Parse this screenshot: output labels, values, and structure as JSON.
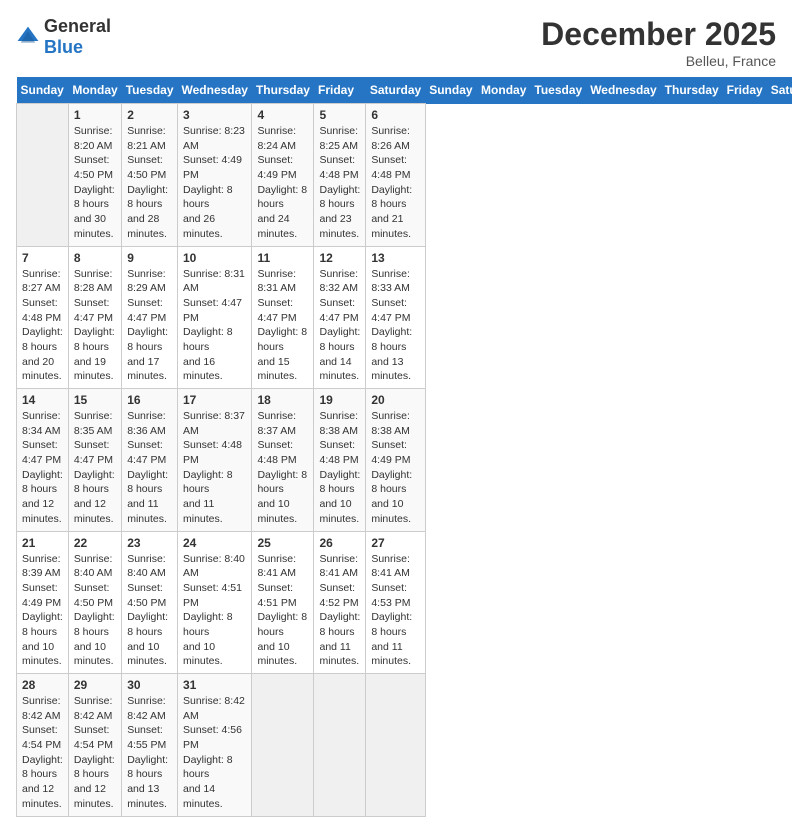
{
  "header": {
    "logo_general": "General",
    "logo_blue": "Blue",
    "month_title": "December 2025",
    "location": "Belleu, France"
  },
  "days_of_week": [
    "Sunday",
    "Monday",
    "Tuesday",
    "Wednesday",
    "Thursday",
    "Friday",
    "Saturday"
  ],
  "weeks": [
    [
      {
        "day": "",
        "info": ""
      },
      {
        "day": "1",
        "info": "Sunrise: 8:20 AM\nSunset: 4:50 PM\nDaylight: 8 hours\nand 30 minutes."
      },
      {
        "day": "2",
        "info": "Sunrise: 8:21 AM\nSunset: 4:50 PM\nDaylight: 8 hours\nand 28 minutes."
      },
      {
        "day": "3",
        "info": "Sunrise: 8:23 AM\nSunset: 4:49 PM\nDaylight: 8 hours\nand 26 minutes."
      },
      {
        "day": "4",
        "info": "Sunrise: 8:24 AM\nSunset: 4:49 PM\nDaylight: 8 hours\nand 24 minutes."
      },
      {
        "day": "5",
        "info": "Sunrise: 8:25 AM\nSunset: 4:48 PM\nDaylight: 8 hours\nand 23 minutes."
      },
      {
        "day": "6",
        "info": "Sunrise: 8:26 AM\nSunset: 4:48 PM\nDaylight: 8 hours\nand 21 minutes."
      }
    ],
    [
      {
        "day": "7",
        "info": "Sunrise: 8:27 AM\nSunset: 4:48 PM\nDaylight: 8 hours\nand 20 minutes."
      },
      {
        "day": "8",
        "info": "Sunrise: 8:28 AM\nSunset: 4:47 PM\nDaylight: 8 hours\nand 19 minutes."
      },
      {
        "day": "9",
        "info": "Sunrise: 8:29 AM\nSunset: 4:47 PM\nDaylight: 8 hours\nand 17 minutes."
      },
      {
        "day": "10",
        "info": "Sunrise: 8:31 AM\nSunset: 4:47 PM\nDaylight: 8 hours\nand 16 minutes."
      },
      {
        "day": "11",
        "info": "Sunrise: 8:31 AM\nSunset: 4:47 PM\nDaylight: 8 hours\nand 15 minutes."
      },
      {
        "day": "12",
        "info": "Sunrise: 8:32 AM\nSunset: 4:47 PM\nDaylight: 8 hours\nand 14 minutes."
      },
      {
        "day": "13",
        "info": "Sunrise: 8:33 AM\nSunset: 4:47 PM\nDaylight: 8 hours\nand 13 minutes."
      }
    ],
    [
      {
        "day": "14",
        "info": "Sunrise: 8:34 AM\nSunset: 4:47 PM\nDaylight: 8 hours\nand 12 minutes."
      },
      {
        "day": "15",
        "info": "Sunrise: 8:35 AM\nSunset: 4:47 PM\nDaylight: 8 hours\nand 12 minutes."
      },
      {
        "day": "16",
        "info": "Sunrise: 8:36 AM\nSunset: 4:47 PM\nDaylight: 8 hours\nand 11 minutes."
      },
      {
        "day": "17",
        "info": "Sunrise: 8:37 AM\nSunset: 4:48 PM\nDaylight: 8 hours\nand 11 minutes."
      },
      {
        "day": "18",
        "info": "Sunrise: 8:37 AM\nSunset: 4:48 PM\nDaylight: 8 hours\nand 10 minutes."
      },
      {
        "day": "19",
        "info": "Sunrise: 8:38 AM\nSunset: 4:48 PM\nDaylight: 8 hours\nand 10 minutes."
      },
      {
        "day": "20",
        "info": "Sunrise: 8:38 AM\nSunset: 4:49 PM\nDaylight: 8 hours\nand 10 minutes."
      }
    ],
    [
      {
        "day": "21",
        "info": "Sunrise: 8:39 AM\nSunset: 4:49 PM\nDaylight: 8 hours\nand 10 minutes."
      },
      {
        "day": "22",
        "info": "Sunrise: 8:40 AM\nSunset: 4:50 PM\nDaylight: 8 hours\nand 10 minutes."
      },
      {
        "day": "23",
        "info": "Sunrise: 8:40 AM\nSunset: 4:50 PM\nDaylight: 8 hours\nand 10 minutes."
      },
      {
        "day": "24",
        "info": "Sunrise: 8:40 AM\nSunset: 4:51 PM\nDaylight: 8 hours\nand 10 minutes."
      },
      {
        "day": "25",
        "info": "Sunrise: 8:41 AM\nSunset: 4:51 PM\nDaylight: 8 hours\nand 10 minutes."
      },
      {
        "day": "26",
        "info": "Sunrise: 8:41 AM\nSunset: 4:52 PM\nDaylight: 8 hours\nand 11 minutes."
      },
      {
        "day": "27",
        "info": "Sunrise: 8:41 AM\nSunset: 4:53 PM\nDaylight: 8 hours\nand 11 minutes."
      }
    ],
    [
      {
        "day": "28",
        "info": "Sunrise: 8:42 AM\nSunset: 4:54 PM\nDaylight: 8 hours\nand 12 minutes."
      },
      {
        "day": "29",
        "info": "Sunrise: 8:42 AM\nSunset: 4:54 PM\nDaylight: 8 hours\nand 12 minutes."
      },
      {
        "day": "30",
        "info": "Sunrise: 8:42 AM\nSunset: 4:55 PM\nDaylight: 8 hours\nand 13 minutes."
      },
      {
        "day": "31",
        "info": "Sunrise: 8:42 AM\nSunset: 4:56 PM\nDaylight: 8 hours\nand 14 minutes."
      },
      {
        "day": "",
        "info": ""
      },
      {
        "day": "",
        "info": ""
      },
      {
        "day": "",
        "info": ""
      }
    ]
  ]
}
